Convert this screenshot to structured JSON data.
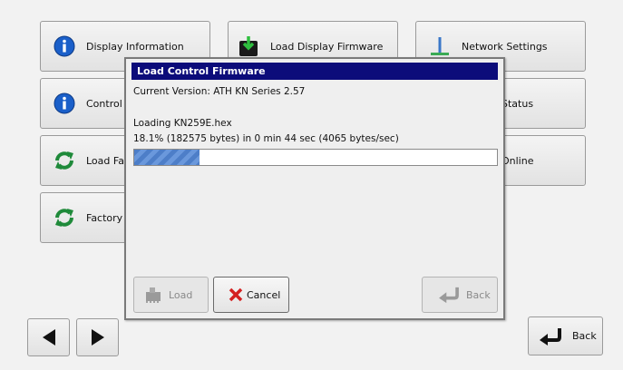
{
  "buttons": {
    "display_info": "Display Information",
    "load_display_firmware": "Load Display Firmware",
    "network_settings": "Network Settings",
    "control_info": "Control In",
    "status": "Status",
    "load_factory": "Load Fac",
    "online": "Online",
    "factory_reset": "Factory R"
  },
  "nav": {
    "back_label": "Back"
  },
  "dialog": {
    "title": "Load Control Firmware",
    "current_version": "Current Version: ATH KN Series 2.57",
    "loading_file": "Loading KN259E.hex",
    "progress_text": "18.1% (182575 bytes) in 0 min 44 sec (4065 bytes/sec)",
    "progress_fraction": 0.181,
    "load_label": "Load",
    "cancel_label": "Cancel",
    "back_label": "Back"
  },
  "colors": {
    "title_bar": "#0c0c7a",
    "info_icon": "#1a5fc9",
    "refresh_icon": "#1f8a3a",
    "cancel_x": "#d42020"
  }
}
